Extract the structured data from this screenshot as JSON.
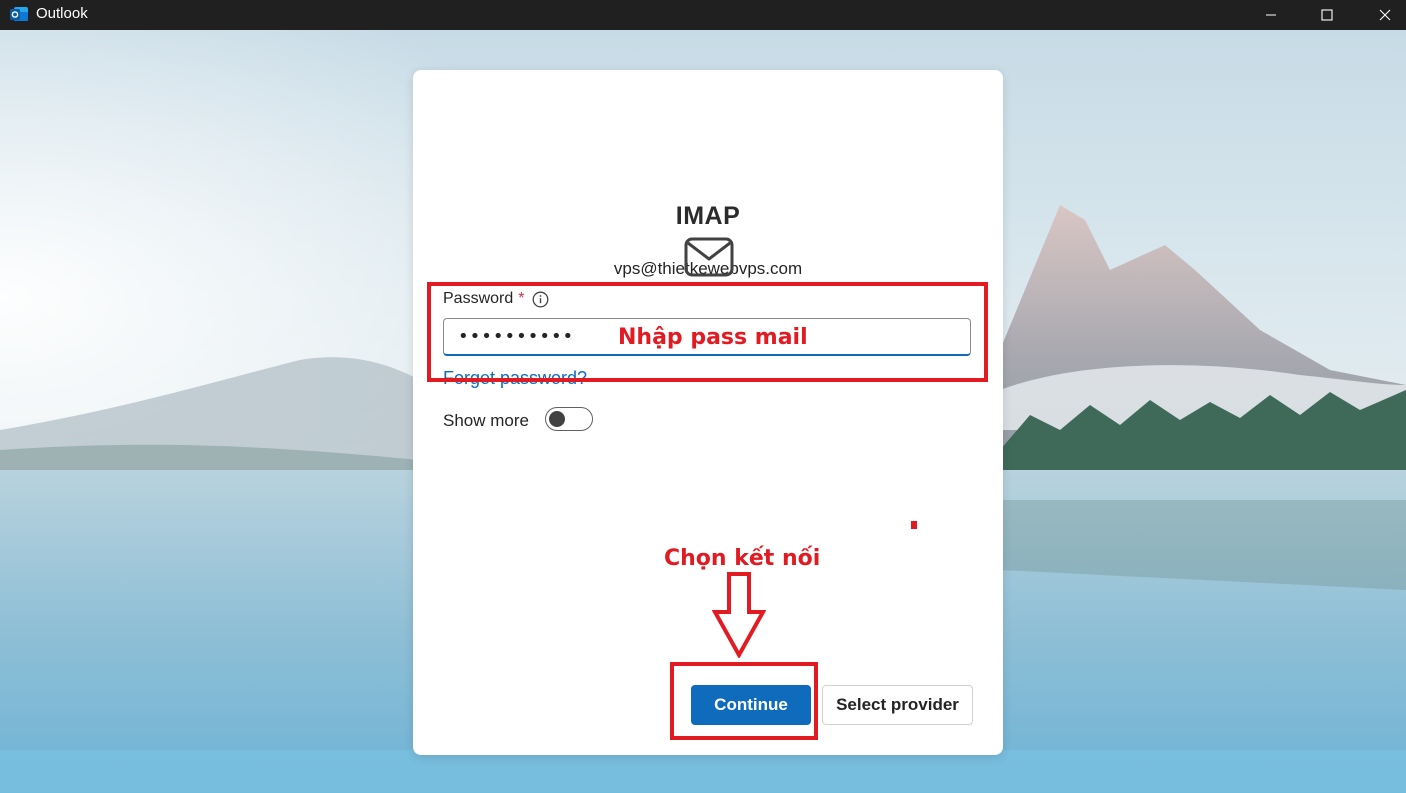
{
  "window": {
    "title": "Outlook",
    "controls": [
      "minimize-icon",
      "maximize-icon",
      "close-icon"
    ]
  },
  "dialog": {
    "title": "IMAP",
    "email": "vps@thietkewebvps.com",
    "icon": "mail-icon",
    "password": {
      "label": "Password",
      "required_mark": "*",
      "value": "••••••••••"
    },
    "forgot_label": "Forget password?",
    "show_more": {
      "label": "Show more",
      "on": false
    },
    "buttons": {
      "continue": "Continue",
      "select_provider": "Select provider"
    }
  },
  "annotations": {
    "password_hint": "Nhập pass mail",
    "connect_hint": "Chọn kết nối"
  },
  "colors": {
    "accent": "#0f6cbd",
    "annotation": "#e21b23",
    "required": "#c4314b",
    "titlebar": "#202020"
  }
}
